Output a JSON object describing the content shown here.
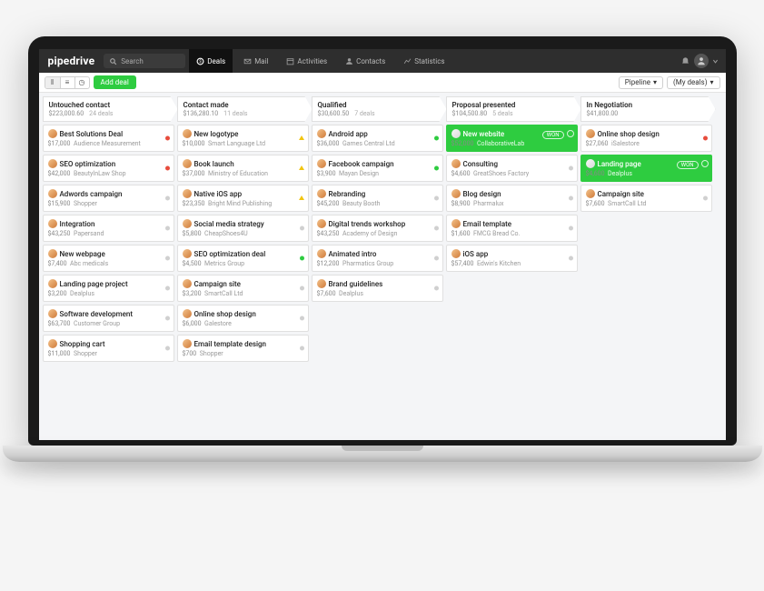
{
  "brand": "pipedrive",
  "search": {
    "placeholder": "Search"
  },
  "nav": {
    "deals": "Deals",
    "mail": "Mail",
    "activities": "Activities",
    "contacts": "Contacts",
    "statistics": "Statistics"
  },
  "toolbar": {
    "add_deal": "Add deal",
    "pipeline_filter": "Pipeline",
    "mydeals_filter": "(My deals)"
  },
  "columns": [
    {
      "title": "Untouched contact",
      "total": "$223,000.60",
      "count": "24 deals",
      "cards": [
        {
          "title": "Best Solutions Deal",
          "amount": "$17,000",
          "org": "Audience Measurement",
          "status": "red"
        },
        {
          "title": "SEO optimization",
          "amount": "$42,000",
          "org": "BeautyInLaw Shop",
          "status": "red"
        },
        {
          "title": "Adwords campaign",
          "amount": "$15,900",
          "org": "Shopper",
          "status": "gray"
        },
        {
          "title": "Integration",
          "amount": "$43,250",
          "org": "Papersand",
          "status": "gray"
        },
        {
          "title": "New webpage",
          "amount": "$7,400",
          "org": "Abc medicals",
          "status": "gray"
        },
        {
          "title": "Landing page project",
          "amount": "$3,200",
          "org": "Dealplus",
          "status": "gray"
        },
        {
          "title": "Software development",
          "amount": "$63,700",
          "org": "Customer Group",
          "status": "gray"
        },
        {
          "title": "Shopping cart",
          "amount": "$11,000",
          "org": "Shopper",
          "status": "gray"
        }
      ]
    },
    {
      "title": "Contact made",
      "total": "$136,280.10",
      "count": "11 deals",
      "cards": [
        {
          "title": "New logotype",
          "amount": "$10,000",
          "org": "Smart Language Ltd",
          "status": "yellow"
        },
        {
          "title": "Book launch",
          "amount": "$37,000",
          "org": "Ministry of Education",
          "status": "yellow"
        },
        {
          "title": "Native iOS app",
          "amount": "$23,350",
          "org": "Bright Mind Publishing",
          "status": "yellow"
        },
        {
          "title": "Social media strategy",
          "amount": "$5,800",
          "org": "CheapShoes4U",
          "status": "gray"
        },
        {
          "title": "SEO optimization deal",
          "amount": "$4,500",
          "org": "Metrics Group",
          "status": "green"
        },
        {
          "title": "Campaign site",
          "amount": "$3,200",
          "org": "SmartCall Ltd",
          "status": "gray"
        },
        {
          "title": "Online shop design",
          "amount": "$6,000",
          "org": "Galestore",
          "status": "gray"
        },
        {
          "title": "Email template design",
          "amount": "$700",
          "org": "Shopper",
          "status": "gray"
        }
      ]
    },
    {
      "title": "Qualified",
      "total": "$30,600.50",
      "count": "7 deals",
      "cards": [
        {
          "title": "Android app",
          "amount": "$36,000",
          "org": "Games Central Ltd",
          "status": "green"
        },
        {
          "title": "Facebook campaign",
          "amount": "$3,900",
          "org": "Mayan Design",
          "status": "green"
        },
        {
          "title": "Rebranding",
          "amount": "$45,200",
          "org": "Beauty Booth",
          "status": "gray"
        },
        {
          "title": "Digital trends workshop",
          "amount": "$43,250",
          "org": "Academy of Design",
          "status": "gray"
        },
        {
          "title": "Animated intro",
          "amount": "$12,200",
          "org": "Pharmatics Group",
          "status": "gray"
        },
        {
          "title": "Brand guidelines",
          "amount": "$7,600",
          "org": "Dealplus",
          "status": "gray"
        }
      ]
    },
    {
      "title": "Proposal presented",
      "total": "$104,500.80",
      "count": "5 deals",
      "cards": [
        {
          "title": "New website",
          "amount": "$52,000",
          "org": "CollaborativeLab",
          "won": true
        },
        {
          "title": "Consulting",
          "amount": "$4,600",
          "org": "GreatShoes Factory",
          "status": "gray"
        },
        {
          "title": "Blog design",
          "amount": "$8,900",
          "org": "Pharmalux",
          "status": "gray"
        },
        {
          "title": "Email template",
          "amount": "$1,600",
          "org": "FMCG Bread Co.",
          "status": "gray"
        },
        {
          "title": "iOS app",
          "amount": "$57,400",
          "org": "Edwin's Kitchen",
          "status": "gray"
        }
      ]
    },
    {
      "title": "In Negotiation",
      "total": "$41,800.00",
      "count": "",
      "cards": [
        {
          "title": "Online shop design",
          "amount": "$27,060",
          "org": "iSalestore",
          "status": "red"
        },
        {
          "title": "Landing page",
          "amount": "$4,600",
          "org": "Dealplus",
          "won": true
        },
        {
          "title": "Campaign site",
          "amount": "$7,600",
          "org": "SmartCall Ltd",
          "status": "gray"
        }
      ]
    }
  ],
  "won_label": "WON"
}
